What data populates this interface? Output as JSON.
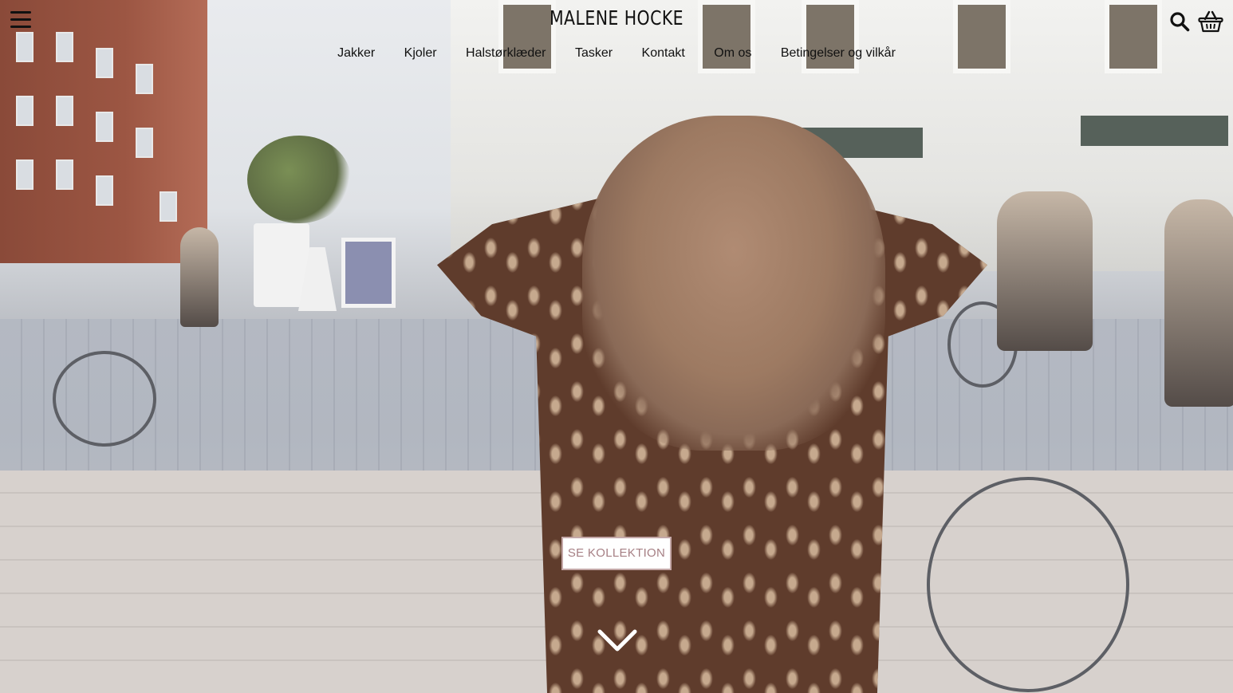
{
  "site": {
    "title": "MALENE HOCKE"
  },
  "nav": {
    "items": [
      {
        "label": "Jakker"
      },
      {
        "label": "Kjoler"
      },
      {
        "label": "Halstørklæder"
      },
      {
        "label": "Tasker"
      },
      {
        "label": "Kontakt"
      },
      {
        "label": "Om os"
      },
      {
        "label": "Betingelser og vilkår"
      }
    ]
  },
  "icons": {
    "menu": "menu-icon",
    "search": "search-icon",
    "basket": "basket-icon",
    "scroll": "chevron-down-icon"
  },
  "hero": {
    "cta_label": "SE KOLLEKTION"
  },
  "colors": {
    "cta_border": "#c4a8a8",
    "cta_text": "#a67f84",
    "text": "#111111"
  }
}
